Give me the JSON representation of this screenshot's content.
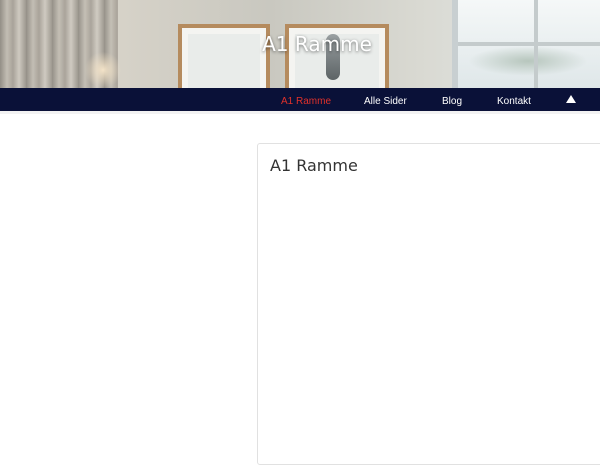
{
  "header": {
    "site_title": "A1 Ramme"
  },
  "nav": {
    "items": [
      {
        "label": "A1 Ramme",
        "active": true
      },
      {
        "label": "Alle Sider",
        "active": false
      },
      {
        "label": "Blog",
        "active": false
      },
      {
        "label": "Kontakt",
        "active": false
      }
    ],
    "scroll_top_icon": "triangle-up-icon"
  },
  "main": {
    "card_title": "A1 Ramme"
  },
  "colors": {
    "nav_background": "#0a1138",
    "active_link": "#e0312a"
  }
}
